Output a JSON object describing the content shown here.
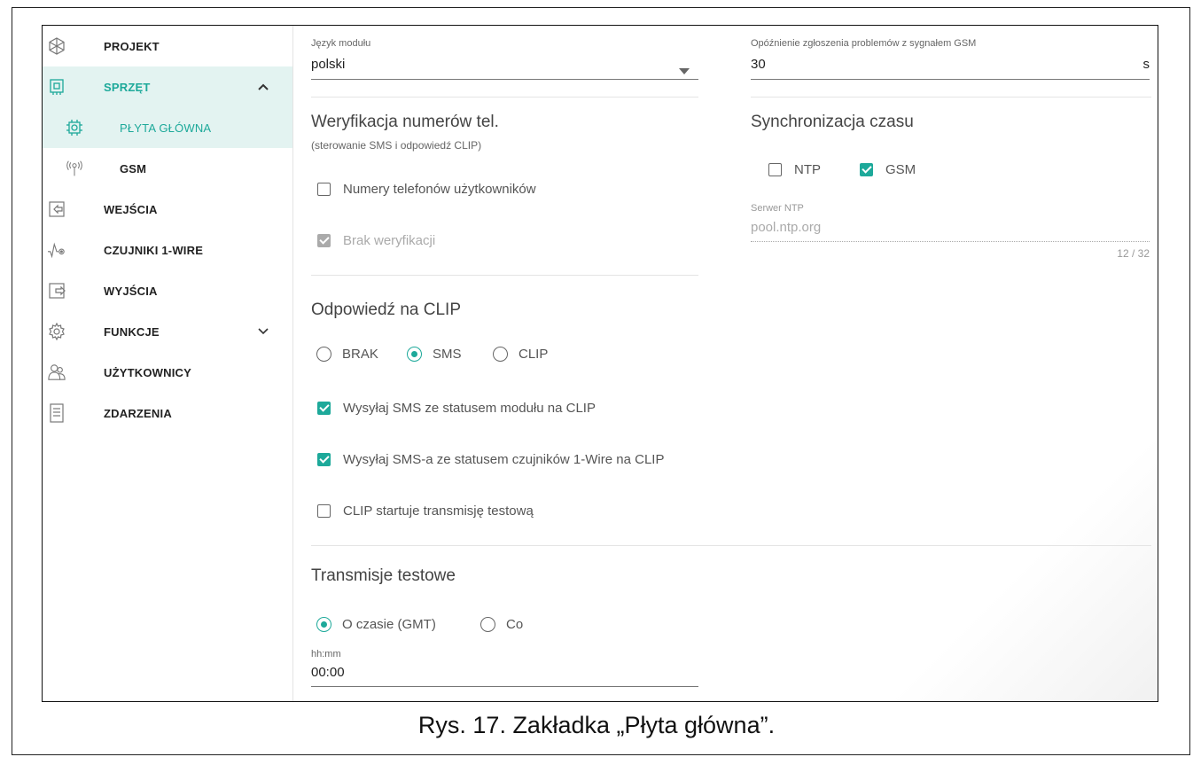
{
  "sidebar": {
    "items": [
      {
        "label": "PROJEKT"
      },
      {
        "label": "SPRZĘT"
      },
      {
        "label": "PŁYTA GŁÓWNA"
      },
      {
        "label": "GSM"
      },
      {
        "label": "WEJŚCIA"
      },
      {
        "label": "CZUJNIKI 1-WIRE"
      },
      {
        "label": "WYJŚCIA"
      },
      {
        "label": "FUNKCJE"
      },
      {
        "label": "UŻYTKOWNICY"
      },
      {
        "label": "ZDARZENIA"
      }
    ]
  },
  "module_language": {
    "label": "Język modułu",
    "value": "polski"
  },
  "gsm_delay": {
    "label": "Opóźnienie zgłoszenia problemów z sygnałem GSM",
    "value": "30",
    "unit": "s"
  },
  "verification": {
    "title": "Weryfikacja numerów tel.",
    "subtitle": "(sterowanie SMS i odpowiedź CLIP)",
    "user_numbers": "Numery telefonów użytkowników",
    "no_verification": "Brak weryfikacji"
  },
  "time_sync": {
    "title": "Synchronizacja czasu",
    "ntp": "NTP",
    "gsm": "GSM",
    "server_label": "Serwer NTP",
    "server_value": "pool.ntp.org",
    "counter": "12 / 32"
  },
  "clip": {
    "title": "Odpowiedź na CLIP",
    "opt_none": "BRAK",
    "opt_sms": "SMS",
    "opt_clip": "CLIP",
    "send_status": "Wysyłaj SMS ze statusem modułu na CLIP",
    "send_sensors": "Wysyłaj SMS-a ze statusem czujników 1-Wire na CLIP",
    "start_test": "CLIP startuje transmisję testową"
  },
  "test_transmissions": {
    "title": "Transmisje testowe",
    "opt_time": "O czasie (GMT)",
    "opt_every": "Co",
    "time_label": "hh:mm",
    "time_value": "00:00"
  },
  "caption": "Rys. 17. Zakładka „Płyta główna”.",
  "colors": {
    "accent": "#1da99a",
    "active_bg": "#e3f3f1"
  }
}
